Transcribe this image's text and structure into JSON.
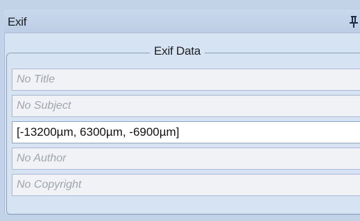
{
  "window": {
    "title": "Exif",
    "pin_icon": "pushpin-icon"
  },
  "group": {
    "legend": "Exif Data"
  },
  "fields": [
    {
      "name": "title-field",
      "text": "No Title",
      "placeholder": true
    },
    {
      "name": "subject-field",
      "text": "No Subject",
      "placeholder": true
    },
    {
      "name": "coordinates-field",
      "text": "[-13200µm, 6300µm, -6900µm]",
      "placeholder": false
    },
    {
      "name": "author-field",
      "text": "No Author",
      "placeholder": true
    },
    {
      "name": "copyright-field",
      "text": "No Copyright",
      "placeholder": true
    }
  ],
  "colors": {
    "titlebar": "#c2d2e7",
    "panel": "#d6e3f3",
    "field_placeholder_text": "#a0a4ab"
  }
}
